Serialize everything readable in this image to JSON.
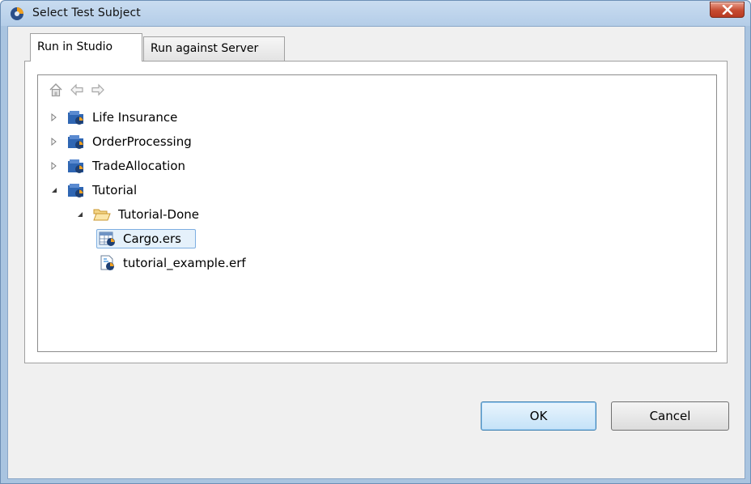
{
  "window": {
    "title": "Select Test Subject",
    "app_icon": "studio-app-icon",
    "close_icon": "close-icon"
  },
  "tabs": [
    {
      "label": "Run in Studio",
      "active": true
    },
    {
      "label": "Run against Server",
      "active": false
    }
  ],
  "navigation": {
    "home_icon": "home-icon",
    "back_icon": "back-arrow-icon",
    "forward_icon": "forward-arrow-icon"
  },
  "tree": [
    {
      "label": "Life Insurance",
      "type": "project",
      "expanded": false
    },
    {
      "label": "OrderProcessing",
      "type": "project",
      "expanded": false
    },
    {
      "label": "TradeAllocation",
      "type": "project",
      "expanded": false
    },
    {
      "label": "Tutorial",
      "type": "project",
      "expanded": true
    },
    {
      "label": "Tutorial-Done",
      "type": "folder",
      "expanded": true
    },
    {
      "label": "Cargo.ers",
      "type": "ruleset-file",
      "selected": true
    },
    {
      "label": "tutorial_example.erf",
      "type": "rule-file",
      "selected": false
    }
  ],
  "buttons": {
    "ok_label": "OK",
    "cancel_label": "Cancel"
  },
  "colors": {
    "selection_fill": "#e5f1fb",
    "selection_border": "#7daee1",
    "close_button": "#c64b31",
    "project_icon": "#2f66b3"
  }
}
